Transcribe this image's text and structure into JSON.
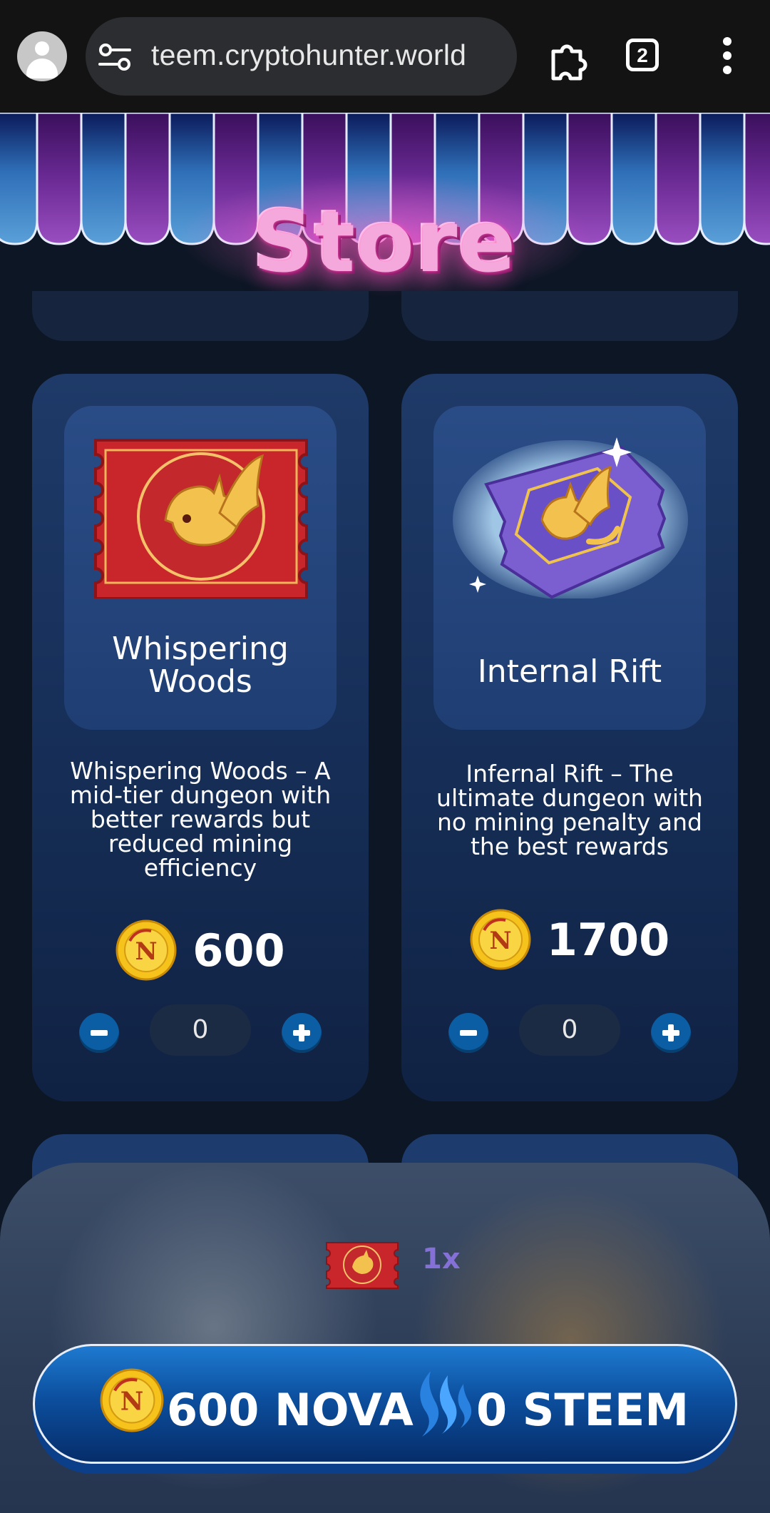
{
  "browser": {
    "url": "teem.cryptohunter.world",
    "tab_count": "2"
  },
  "header": {
    "title": "Store"
  },
  "products": [
    {
      "name": "Whispering Woods",
      "description": "Whispering Woods – A mid-tier dungeon with better rewards but reduced mining efficiency",
      "price": "600",
      "quantity": "0",
      "ticket_color": "#c8262b"
    },
    {
      "name": "Internal Rift",
      "description": "Infernal Rift – The ultimate dungeon with no mining penalty and the best rewards",
      "price": "1700",
      "quantity": "0",
      "ticket_color": "#7b5fd0"
    }
  ],
  "cart": {
    "item_qty": "1x",
    "total_nova": "600 NOVA",
    "total_steem": "0 STEEM"
  },
  "icons": {
    "profile": "account-circle-icon",
    "site_info": "tune-icon",
    "extensions": "puzzle-icon",
    "menu": "more-vert-icon",
    "currency": "nova-coin-icon",
    "steem": "steem-logo-icon"
  }
}
